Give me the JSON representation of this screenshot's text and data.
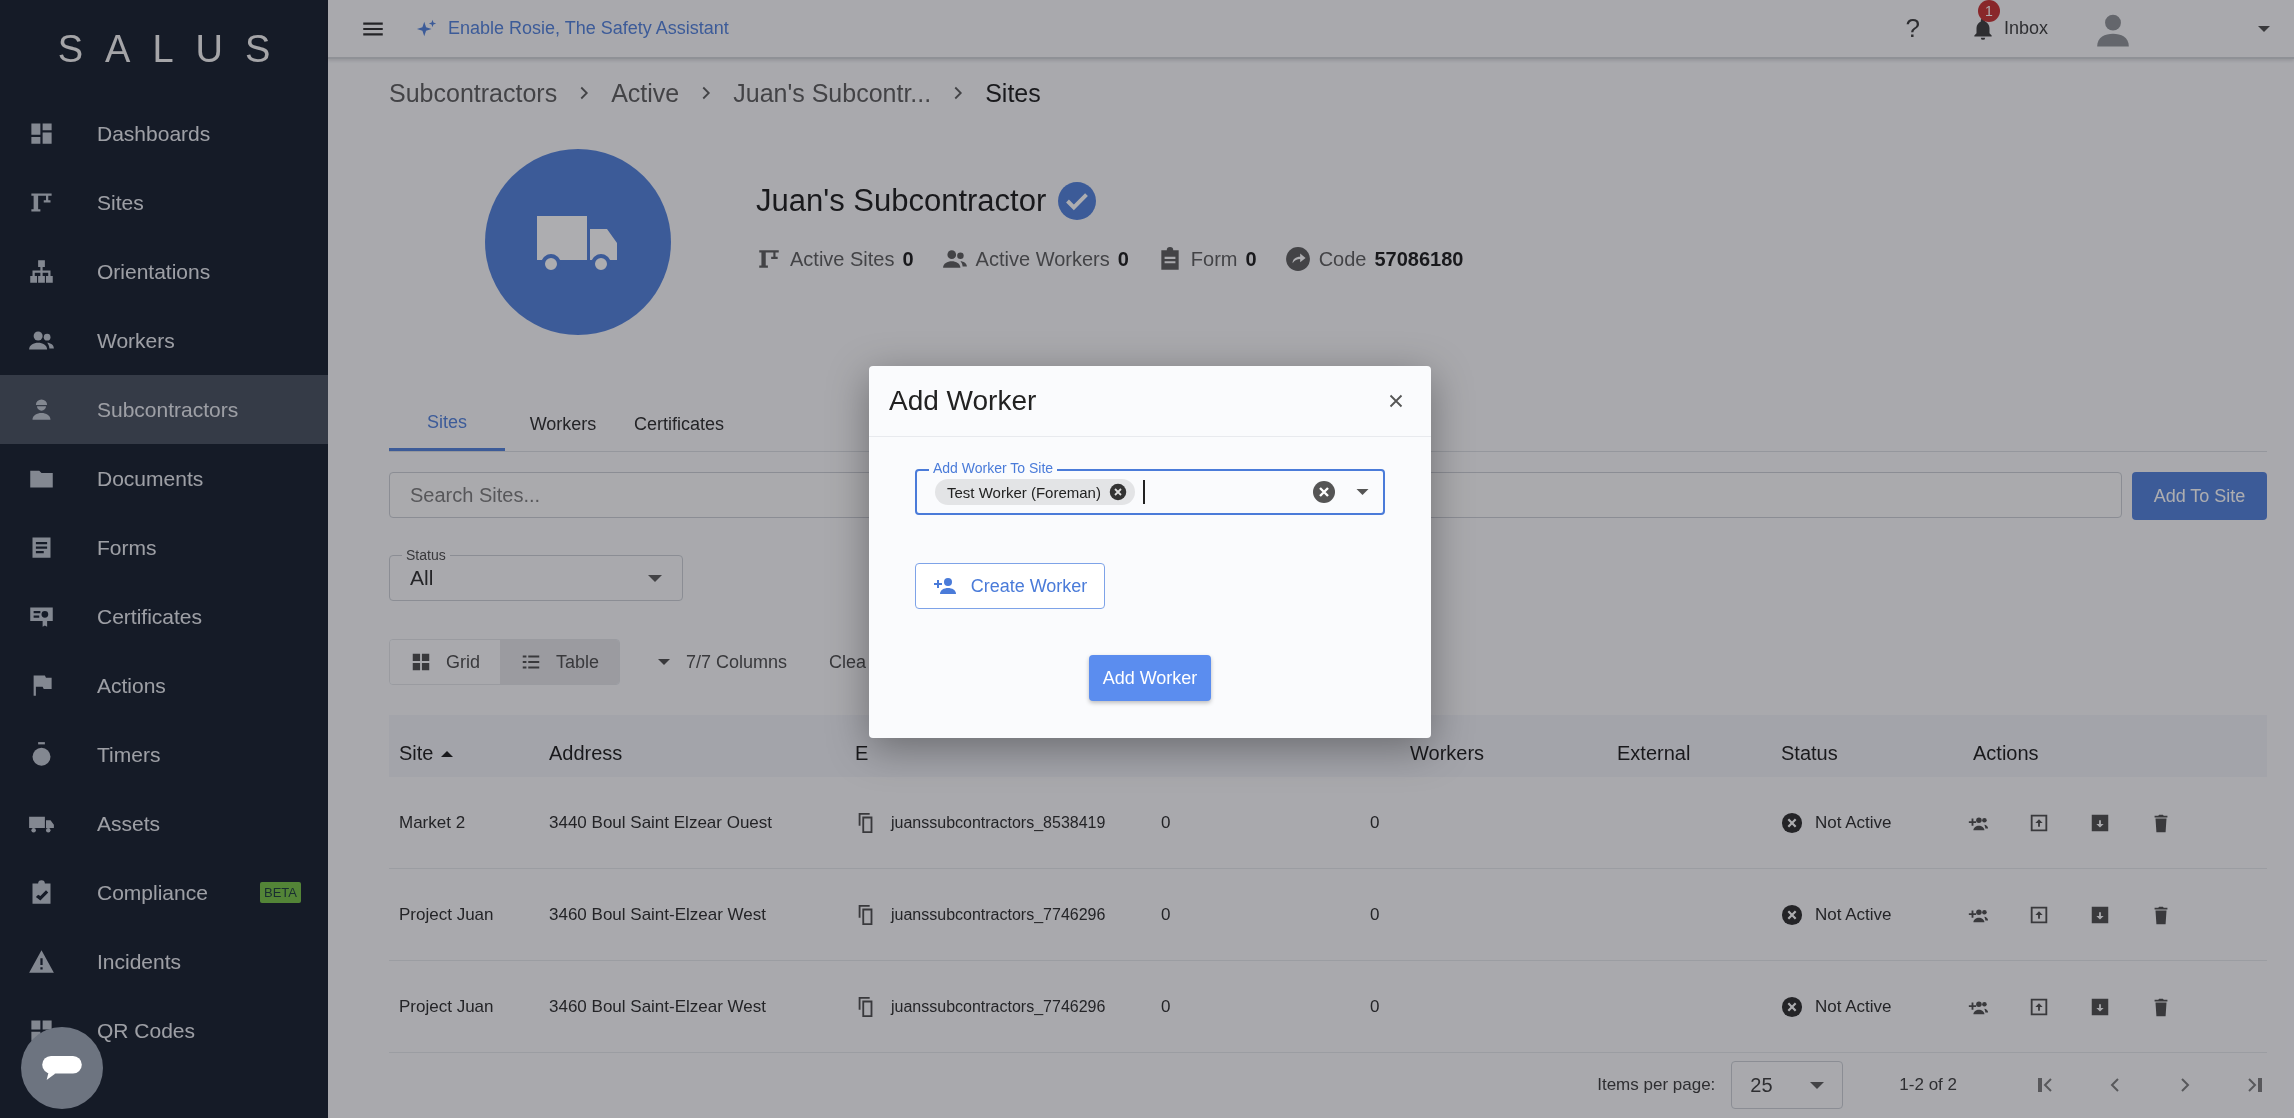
{
  "sidebar": {
    "logo": "SALUS",
    "items": [
      {
        "label": "Dashboards",
        "selected": false
      },
      {
        "label": "Sites",
        "selected": false
      },
      {
        "label": "Orientations",
        "selected": false
      },
      {
        "label": "Workers",
        "selected": false
      },
      {
        "label": "Subcontractors",
        "selected": true
      },
      {
        "label": "Documents",
        "selected": false
      },
      {
        "label": "Forms",
        "selected": false
      },
      {
        "label": "Certificates",
        "selected": false
      },
      {
        "label": "Actions",
        "selected": false
      },
      {
        "label": "Timers",
        "selected": false
      },
      {
        "label": "Assets",
        "selected": false
      },
      {
        "label": "Compliance",
        "selected": false,
        "badge": "BETA"
      },
      {
        "label": "Incidents",
        "selected": false
      },
      {
        "label": "QR Codes",
        "selected": false
      }
    ]
  },
  "header": {
    "assistant_link": "Enable Rosie, The Safety Assistant",
    "help": "?",
    "inbox": {
      "label": "Inbox",
      "count": "1"
    }
  },
  "breadcrumbs": [
    "Subcontractors",
    "Active",
    "Juan's Subcontr...",
    "Sites"
  ],
  "profile": {
    "name": "Juan's Subcontractor",
    "verified": true,
    "stats": [
      {
        "kind": "sites",
        "label": "Active Sites",
        "value": "0"
      },
      {
        "kind": "workers",
        "label": "Active Workers",
        "value": "0"
      },
      {
        "kind": "form",
        "label": "Form",
        "value": "0"
      },
      {
        "kind": "code",
        "label": "Code",
        "value": "57086180"
      }
    ]
  },
  "tabs": [
    {
      "label": "Sites",
      "selected": true
    },
    {
      "label": "Workers",
      "selected": false
    },
    {
      "label": "Certificates",
      "selected": false
    }
  ],
  "search": {
    "placeholder": "Search Sites..."
  },
  "add_to_site_button": "Add To Site",
  "status_filter": {
    "label": "Status",
    "value": "All"
  },
  "view_toggle": [
    {
      "kind": "grid",
      "label": "Grid",
      "selected": false
    },
    {
      "kind": "table",
      "label": "Table",
      "selected": true
    }
  ],
  "columns_menu": "7/7 Columns",
  "clear_link": "Clea",
  "table": {
    "columns": [
      {
        "label": "Site",
        "sorted_ascending": true
      },
      {
        "label": "Address"
      },
      {
        "label": "E"
      },
      {
        "label": "Workers"
      },
      {
        "label": "External"
      },
      {
        "label": "Status"
      },
      {
        "label": "Actions"
      }
    ],
    "rows": [
      {
        "site": "Market 2",
        "address": "3440 Boul Saint Elzear Ouest",
        "email": "juanssubcontractors_8538419",
        "total_forms": "0",
        "active_workers": "0",
        "status": {
          "kind": "not_active",
          "label": "Not Active"
        }
      },
      {
        "site": "Project Juan",
        "address": "3460 Boul Saint-Elzear West",
        "email": "juanssubcontractors_7746296",
        "total_forms": "0",
        "active_workers": "0",
        "status": {
          "kind": "not_active",
          "label": "Not Active"
        }
      },
      {
        "site": "Project Juan",
        "address": "3460 Boul Saint-Elzear West",
        "email": "juanssubcontractors_7746296",
        "total_forms": "0",
        "active_workers": "0",
        "status": {
          "kind": "not_active",
          "label": "Not Active"
        }
      }
    ]
  },
  "paginator": {
    "label": "Items per page:",
    "page_size": "25",
    "range": "1-2 of 2"
  },
  "dialog": {
    "title": "Add Worker",
    "field_label": "Add Worker To Site",
    "chips": [
      "Test Worker (Foreman)"
    ],
    "create_button": "Create Worker",
    "submit_button": "Add Worker"
  }
}
